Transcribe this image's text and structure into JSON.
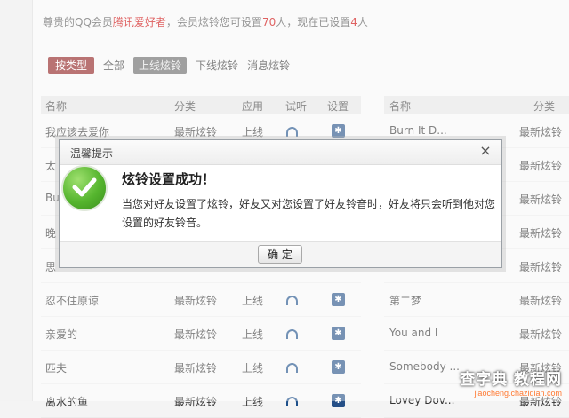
{
  "notice": {
    "prefix": "尊贵的QQ会员",
    "username": "腾讯爱好者",
    "middle": "，会员炫铃您可设置",
    "max": "70",
    "unit1": "人，现在已设置",
    "current": "4",
    "unit2": "人"
  },
  "filters": [
    "按类型",
    "全部",
    "上线炫铃",
    "下线炫铃",
    "消息炫铃"
  ],
  "table_left": {
    "headers": [
      "名称",
      "分类",
      "应用",
      "试听",
      "设置"
    ],
    "rows": [
      {
        "name": "我应该去爱你",
        "cat": "最新炫铃",
        "app": "上线"
      },
      {
        "name": "太",
        "cat": "",
        "app": ""
      },
      {
        "name": "Bu",
        "cat": "",
        "app": ""
      },
      {
        "name": "晚",
        "cat": "",
        "app": ""
      },
      {
        "name": "思",
        "cat": "",
        "app": ""
      },
      {
        "name": "忍不住原谅",
        "cat": "最新炫铃",
        "app": "上线"
      },
      {
        "name": "亲爱的",
        "cat": "最新炫铃",
        "app": "上线"
      },
      {
        "name": "匹夫",
        "cat": "最新炫铃",
        "app": "上线"
      },
      {
        "name": "离水的鱼",
        "cat": "最新炫铃",
        "app": "上线"
      }
    ]
  },
  "table_right": {
    "headers": [
      "名称",
      "分类"
    ],
    "rows": [
      {
        "name": "Burn It D...",
        "cat": "最新炫铃"
      },
      {
        "name": "",
        "cat": "最新炫铃"
      },
      {
        "name": "",
        "cat": "最新炫铃"
      },
      {
        "name": "",
        "cat": "最新炫铃"
      },
      {
        "name": "",
        "cat": "最新炫铃"
      },
      {
        "name": "第二梦",
        "cat": "最新炫铃"
      },
      {
        "name": "You and I",
        "cat": "最新炫铃"
      },
      {
        "name": "Somebody ...",
        "cat": "最新炫铃"
      },
      {
        "name": "Lovey Dov...",
        "cat": "最新炫铃"
      }
    ]
  },
  "dialog": {
    "title": "温馨提示",
    "close": "×",
    "message_title": "炫铃设置成功！",
    "message_body": "当您对好友设置了炫铃，好友又对您设置了好友铃音时，好友将只会听到他对您设置的好友铃音。",
    "ok_label": "确 定"
  },
  "watermark": {
    "main": "查字典 教程网",
    "sub": "jiaocheng.chazidian.com"
  }
}
